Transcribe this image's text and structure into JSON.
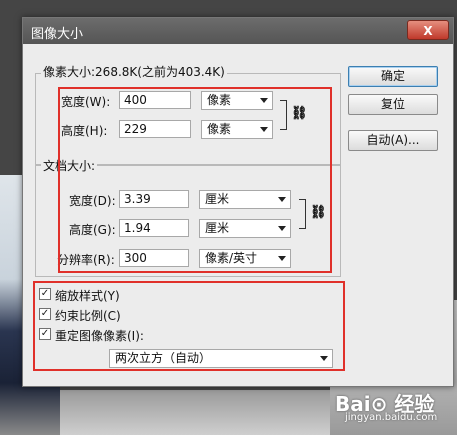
{
  "dialog": {
    "title": "图像大小",
    "close_label": "X"
  },
  "pixel_dimensions": {
    "heading": "像素大小:268.8K(之前为403.4K)",
    "width_label": "宽度(W):",
    "width_value": "400",
    "width_unit": "像素",
    "height_label": "高度(H):",
    "height_value": "229",
    "height_unit": "像素"
  },
  "document_size": {
    "heading": "文档大小:",
    "width_label": "宽度(D):",
    "width_value": "3.39",
    "width_unit": "厘米",
    "height_label": "高度(G):",
    "height_value": "1.94",
    "height_unit": "厘米",
    "resolution_label": "分辨率(R):",
    "resolution_value": "300",
    "resolution_unit": "像素/英寸"
  },
  "buttons": {
    "ok": "确定",
    "reset": "复位",
    "auto": "自动(A)..."
  },
  "options": {
    "scale_styles": "缩放样式(Y)",
    "constrain_proportions": "约束比例(C)",
    "resample": "重定图像像素(I):",
    "resample_method": "两次立方（自动）"
  },
  "watermark": {
    "brand": "Bai⊙ 经验",
    "url": "jingyan.baidu.com"
  }
}
